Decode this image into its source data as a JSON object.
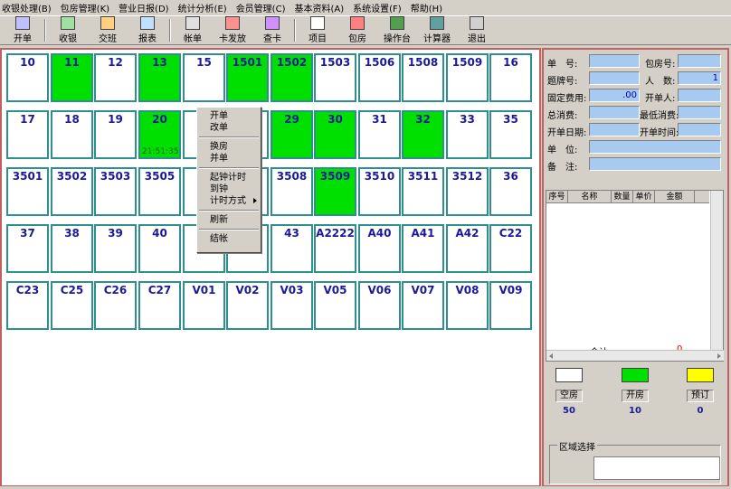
{
  "menu": [
    "收银处理(B)",
    "包房管理(K)",
    "营业日报(D)",
    "统计分析(E)",
    "会员管理(C)",
    "基本资料(A)",
    "系统设置(F)",
    "帮助(H)"
  ],
  "toolbar": [
    {
      "label": "开单",
      "icon": "open-bill-icon"
    },
    {
      "label": "收银",
      "icon": "cashier-icon"
    },
    {
      "label": "交班",
      "icon": "shift-change-icon"
    },
    {
      "label": "报表",
      "icon": "report-icon"
    },
    {
      "label": "帐单",
      "icon": "bill-icon"
    },
    {
      "label": "卡发放",
      "icon": "card-issue-icon"
    },
    {
      "label": "查卡",
      "icon": "card-query-icon"
    },
    {
      "label": "项目",
      "icon": "item-icon"
    },
    {
      "label": "包房",
      "icon": "room-icon"
    },
    {
      "label": "操作台",
      "icon": "console-icon"
    },
    {
      "label": "计算器",
      "icon": "calculator-icon"
    },
    {
      "label": "退出",
      "icon": "exit-icon"
    }
  ],
  "rooms": [
    [
      {
        "n": "10"
      },
      {
        "n": "11",
        "s": "open"
      },
      {
        "n": "12"
      },
      {
        "n": "13",
        "s": "open"
      },
      {
        "n": "15"
      },
      {
        "n": "1501",
        "s": "open"
      },
      {
        "n": "1502",
        "s": "open"
      },
      {
        "n": "1503"
      },
      {
        "n": "1506"
      },
      {
        "n": "1508"
      },
      {
        "n": "1509"
      },
      {
        "n": "16"
      }
    ],
    [
      {
        "n": "17"
      },
      {
        "n": "18"
      },
      {
        "n": "19"
      },
      {
        "n": "20",
        "s": "open",
        "t": "21:51:35"
      },
      {
        "n": ""
      },
      {
        "n": ""
      },
      {
        "n": "29",
        "s": "open"
      },
      {
        "n": "30",
        "s": "open"
      },
      {
        "n": "31"
      },
      {
        "n": "32",
        "s": "open"
      },
      {
        "n": "33"
      },
      {
        "n": "35"
      }
    ],
    [
      {
        "n": "3501"
      },
      {
        "n": "3502"
      },
      {
        "n": "3503"
      },
      {
        "n": "3505"
      },
      {
        "n": "3"
      },
      {
        "n": ""
      },
      {
        "n": "3508"
      },
      {
        "n": "3509",
        "s": "open"
      },
      {
        "n": "3510"
      },
      {
        "n": "3511"
      },
      {
        "n": "3512"
      },
      {
        "n": "36"
      }
    ],
    [
      {
        "n": "37"
      },
      {
        "n": "38"
      },
      {
        "n": "39"
      },
      {
        "n": "40"
      },
      {
        "n": ""
      },
      {
        "n": ""
      },
      {
        "n": "43"
      },
      {
        "n": "A2222"
      },
      {
        "n": "A40"
      },
      {
        "n": "A41"
      },
      {
        "n": "A42"
      },
      {
        "n": "C22"
      }
    ],
    [
      {
        "n": "C23"
      },
      {
        "n": "C25"
      },
      {
        "n": "C26"
      },
      {
        "n": "C27"
      },
      {
        "n": "V01"
      },
      {
        "n": "V02"
      },
      {
        "n": "V03"
      },
      {
        "n": "V05"
      },
      {
        "n": "V06"
      },
      {
        "n": "V07"
      },
      {
        "n": "V08"
      },
      {
        "n": "V09"
      }
    ]
  ],
  "context_menu": {
    "groups": [
      [
        "开单",
        "改单"
      ],
      [
        "换房",
        "并单"
      ],
      [
        "起钟计时",
        "到钟",
        "计时方式"
      ],
      [
        "刷新"
      ],
      [
        "结帐"
      ]
    ]
  },
  "info": {
    "bill_no_label": "单　号:",
    "room_no_label": "包房号:",
    "card_no_label": "题牌号:",
    "persons_label": "人　数:",
    "persons_value": "1",
    "fixed_fee_label": "固定费用:",
    "fixed_fee_value": ".00",
    "opener_label": "开单人:",
    "total_label": "总消费:",
    "min_label": "最低消费:",
    "open_date_label": "开单日期:",
    "open_time_label": "开单时间:",
    "unit_label": "单　位:",
    "remark_label": "备　注:"
  },
  "grid": {
    "columns": [
      "序号",
      "名称",
      "数量",
      "单价",
      "金额"
    ],
    "total_label": "合计",
    "total_value": "0"
  },
  "legend": [
    {
      "label": "空房",
      "count": "50",
      "color": "#ffffff"
    },
    {
      "label": "开房",
      "count": "10",
      "color": "#00e000"
    },
    {
      "label": "预订",
      "count": "0",
      "color": "#ffff00"
    }
  ],
  "zone": {
    "label": "区域选择"
  }
}
